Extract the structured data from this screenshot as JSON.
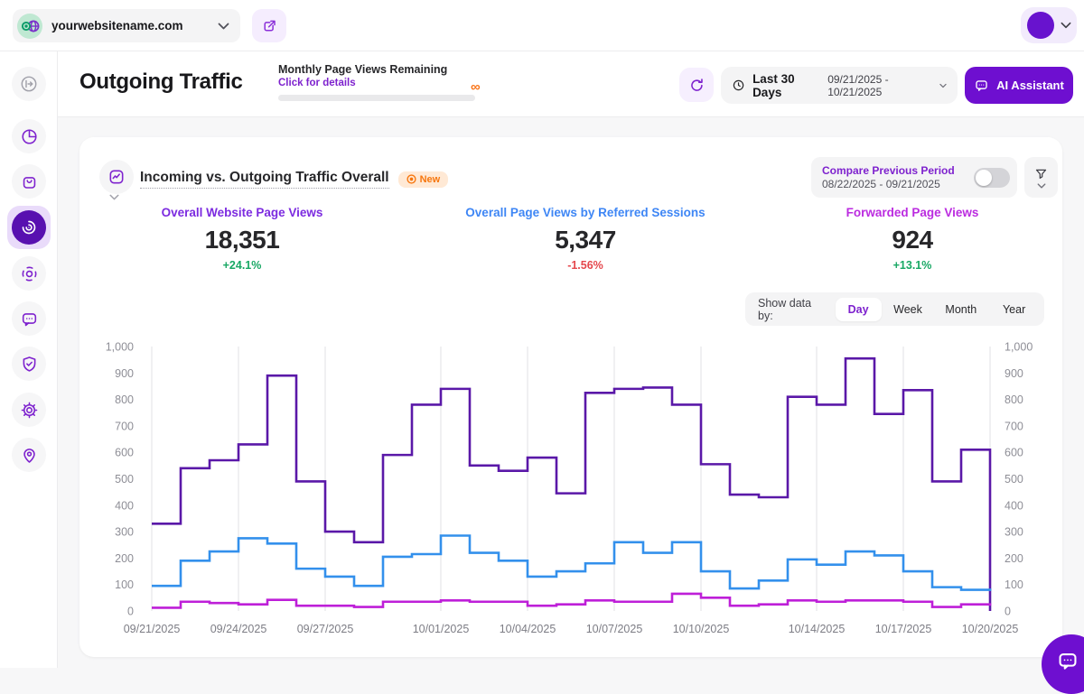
{
  "topbar": {
    "website": "yourwebsitename.com"
  },
  "sidebar": {
    "items": [
      {
        "icon": "collapse-sidebar-icon"
      },
      {
        "icon": "pie-chart-icon"
      },
      {
        "icon": "shopping-bag-icon"
      },
      {
        "icon": "traffic-swirl-icon",
        "active": true
      },
      {
        "icon": "scan-focus-icon"
      },
      {
        "icon": "chat-bubble-icon"
      },
      {
        "icon": "shield-check-icon"
      },
      {
        "icon": "gear-icon"
      },
      {
        "icon": "map-pin-icon"
      }
    ]
  },
  "header": {
    "title": "Outgoing Traffic",
    "monthly": {
      "label": "Monthly Page Views Remaining",
      "link": "Click for details",
      "remaining_symbol": "∞"
    },
    "period": {
      "label": "Last 30 Days",
      "range": "09/21/2025 - 10/21/2025"
    },
    "ai_button": "AI Assistant"
  },
  "card": {
    "title": "Incoming vs. Outgoing Traffic Overall",
    "badge": "New",
    "compare": {
      "label": "Compare Previous Period",
      "range": "08/22/2025 - 09/21/2025",
      "toggle_state": "off"
    },
    "stats": [
      {
        "label": "Overall Website Page Views",
        "value": "18,351",
        "delta": "+24.1%",
        "color": "#7C2BE0",
        "delta_color": "#18A864"
      },
      {
        "label": "Overall Page Views by Referred Sessions",
        "value": "5,347",
        "delta": "-1.56%",
        "color": "#3E86F5",
        "delta_color": "#E5484D"
      },
      {
        "label": "Forwarded Page Views",
        "value": "924",
        "delta": "+13.1%",
        "color": "#BB2BE0",
        "delta_color": "#18A864"
      }
    ],
    "show_data_by": {
      "label": "Show data by:",
      "options": [
        "Day",
        "Week",
        "Month",
        "Year"
      ],
      "active": "Day"
    }
  },
  "chart_data": {
    "type": "line",
    "line_style": "step-after",
    "grid": "vertical-only",
    "ylim": [
      0,
      1000
    ],
    "y_ticks": [
      0,
      100,
      200,
      300,
      400,
      500,
      600,
      700,
      800,
      900,
      1000
    ],
    "y_tick_labels": [
      "0",
      "100",
      "200",
      "300",
      "400",
      "500",
      "600",
      "700",
      "800",
      "900",
      "1,000"
    ],
    "x": [
      "09/21/2025",
      "09/22/2025",
      "09/23/2025",
      "09/24/2025",
      "09/25/2025",
      "09/26/2025",
      "09/27/2025",
      "09/28/2025",
      "09/29/2025",
      "09/30/2025",
      "10/01/2025",
      "10/02/2025",
      "10/03/2025",
      "10/04/2025",
      "10/05/2025",
      "10/06/2025",
      "10/07/2025",
      "10/08/2025",
      "10/09/2025",
      "10/10/2025",
      "10/11/2025",
      "10/12/2025",
      "10/13/2025",
      "10/14/2025",
      "10/15/2025",
      "10/16/2025",
      "10/17/2025",
      "10/18/2025",
      "10/19/2025",
      "10/20/2025"
    ],
    "x_tick_indices": [
      0,
      3,
      6,
      10,
      13,
      16,
      19,
      23,
      26,
      29
    ],
    "series": [
      {
        "name": "Overall Website Page Views",
        "color": "#5A18A8",
        "values": [
          330,
          540,
          570,
          630,
          890,
          490,
          300,
          260,
          590,
          780,
          840,
          550,
          530,
          580,
          445,
          825,
          840,
          845,
          780,
          555,
          440,
          430,
          810,
          780,
          955,
          745,
          835,
          490,
          610,
          0
        ]
      },
      {
        "name": "Overall Page Views by Referred Sessions",
        "color": "#3390EC",
        "values": [
          95,
          190,
          225,
          275,
          255,
          160,
          130,
          95,
          205,
          215,
          285,
          220,
          190,
          130,
          150,
          180,
          260,
          220,
          260,
          150,
          85,
          115,
          195,
          175,
          225,
          210,
          150,
          90,
          80,
          85
        ]
      },
      {
        "name": "Forwarded Page Views",
        "color": "#BE1FD8",
        "values": [
          12,
          35,
          30,
          25,
          42,
          20,
          20,
          15,
          35,
          35,
          40,
          35,
          35,
          20,
          25,
          40,
          35,
          35,
          65,
          50,
          20,
          25,
          40,
          35,
          40,
          40,
          35,
          15,
          25,
          20
        ]
      }
    ]
  }
}
